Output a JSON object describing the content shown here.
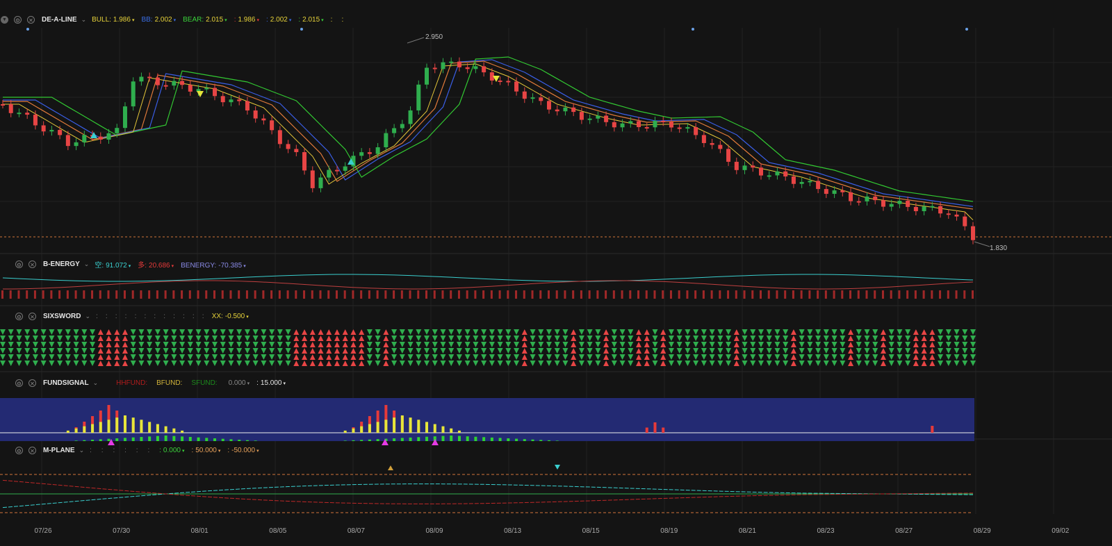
{
  "panels": {
    "main": {
      "name": "DE-A-LINE",
      "items": [
        {
          "label": "BULL:",
          "value": "1.986",
          "color": "#e6d23a"
        },
        {
          "label": "BB:",
          "value": "2.002",
          "color": "#3a6ee6"
        },
        {
          "label": "BEAR:",
          "value": "2.015",
          "color": "#3ad23a"
        },
        {
          "label": ":",
          "value": "1.986",
          "color": "#e63a3a"
        },
        {
          "label": ":",
          "value": "2.002",
          "color": "#3a6ee6"
        },
        {
          "label": ":",
          "value": "2.015",
          "color": "#3ad23a"
        },
        {
          "label": ":",
          "value": "",
          "color": "#e6d23a"
        },
        {
          "label": ":",
          "value": "",
          "color": "#e6d23a"
        }
      ],
      "high_label": "2.950",
      "low_label": "1.830"
    },
    "benergy": {
      "name": "B-ENERGY",
      "items": [
        {
          "label": "空:",
          "value": "91.072",
          "color": "#3acfcf"
        },
        {
          "label": "多:",
          "value": "20.686",
          "color": "#e63a3a"
        },
        {
          "label": "BENERGY:",
          "value": "-70.385",
          "color": "#8a8ae6"
        }
      ]
    },
    "sixsword": {
      "name": "SIXSWORD",
      "items": [
        {
          "label": "XX:",
          "value": "-0.500",
          "color": "#e6d23a"
        }
      ]
    },
    "fundsignal": {
      "name": "FUNDSIGNAL",
      "items": [
        {
          "label": "HHFUND:",
          "value": "",
          "color": "#b01c1c"
        },
        {
          "label": "BFUND:",
          "value": "",
          "color": "#d2b43a"
        },
        {
          "label": "SFUND:",
          "value": "",
          "color": "#1c8a1c"
        },
        {
          "label": "",
          "value": "0.000",
          "color": "#888888"
        },
        {
          "label": ":",
          "value": "15.000",
          "color": "#e6e6e6"
        }
      ]
    },
    "mplane": {
      "name": "M-PLANE",
      "items": [
        {
          "label": ":",
          "value": "0.000",
          "color": "#3ad23a"
        },
        {
          "label": ":",
          "value": "50.000",
          "color": "#e6a05a"
        },
        {
          "label": ":",
          "value": "-50.000",
          "color": "#e6a05a"
        }
      ]
    }
  },
  "x_axis": [
    "07/26",
    "07/30",
    "08/01",
    "08/05",
    "08/07",
    "08/09",
    "08/13",
    "08/15",
    "08/19",
    "08/21",
    "08/23",
    "08/27",
    "08/29",
    "09/02"
  ],
  "colors": {
    "background": "#141414",
    "up": "#2fae4e",
    "down": "#e84545",
    "bull": "#e6c83a",
    "bb": "#3a5ee6",
    "bear": "#32c832",
    "fund_bg": "#232a73",
    "cyan": "#3acfcf"
  },
  "icons": [
    "settings-icon",
    "close-icon",
    "chevron-down-icon",
    "collapse-icon"
  ]
}
